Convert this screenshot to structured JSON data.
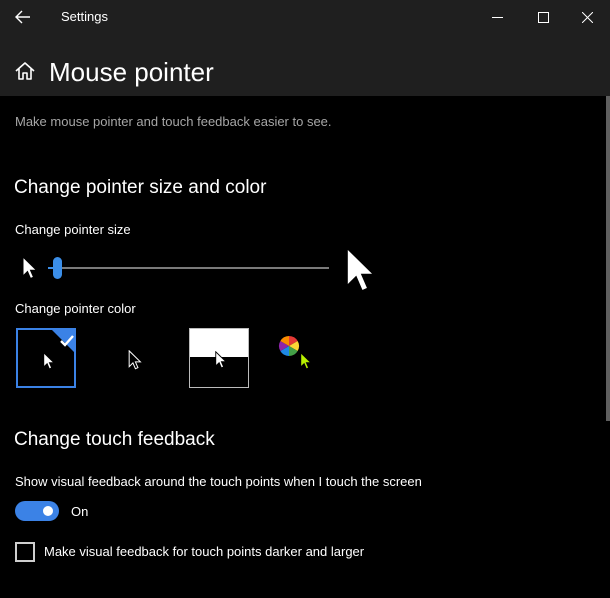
{
  "window": {
    "app_title": "Settings",
    "controls": [
      "minimize-icon",
      "maximize-icon",
      "close-icon"
    ]
  },
  "header": {
    "page_title": "Mouse pointer",
    "home_icon": "home-icon",
    "back_icon": "back-arrow-icon"
  },
  "content": {
    "subtitle": "Make mouse pointer and touch feedback easier to see.",
    "size_color_section": {
      "title": "Change pointer size and color",
      "size_label": "Change pointer size",
      "size_slider_value": 0.02,
      "color_label": "Change pointer color",
      "color_options": [
        "white",
        "black",
        "inverted",
        "custom"
      ],
      "selected_color": "white"
    },
    "touch_section": {
      "title": "Change touch feedback",
      "feedback_label": "Show visual feedback around the touch points when I touch the screen",
      "feedback_toggle": {
        "state": "On",
        "on": true
      },
      "darker_checkbox": {
        "label": "Make visual feedback for touch points darker and larger",
        "checked": false
      }
    }
  },
  "colors": {
    "accent": "#3b82e6",
    "titlebar": "#1f1f1f",
    "background": "#000000",
    "secondary_text": "#a6a6a6"
  }
}
